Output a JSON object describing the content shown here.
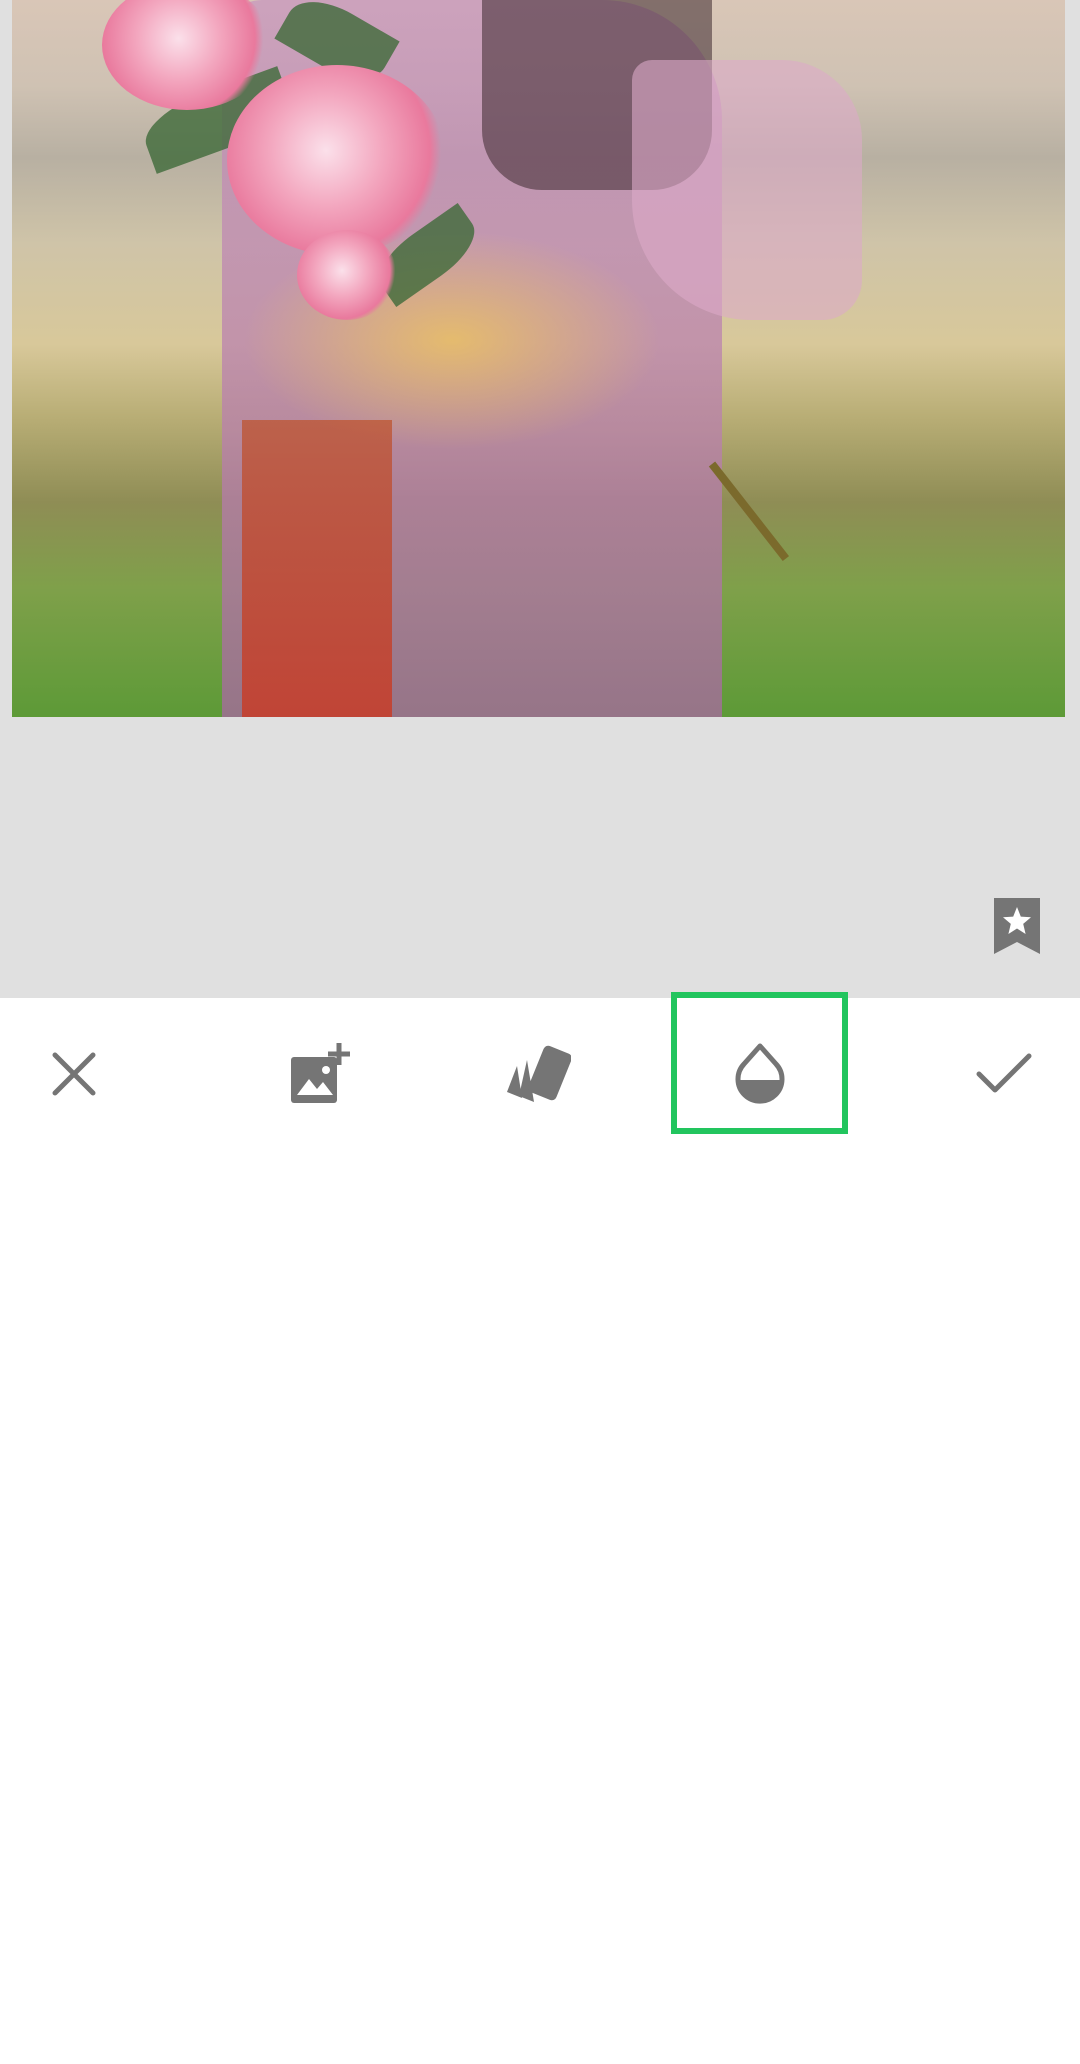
{
  "app": {
    "screen": "double-exposure-editor"
  },
  "canvas": {
    "background_color": "#e0e0e0",
    "photo": {
      "subject": "woman-with-pink-flowers-double-exposure"
    },
    "bookmark_icon": "bookmark-star-icon"
  },
  "toolbar": {
    "background_color": "#ffffff",
    "icon_color": "#757575",
    "buttons": [
      {
        "name": "cancel-button",
        "icon": "close-icon"
      },
      {
        "name": "add-image-button",
        "icon": "add-photo-icon"
      },
      {
        "name": "presets-button",
        "icon": "styles-cards-icon"
      },
      {
        "name": "opacity-button",
        "icon": "opacity-drop-icon",
        "selected": true
      },
      {
        "name": "apply-button",
        "icon": "check-icon"
      }
    ]
  },
  "highlight_color": "#22c55e"
}
